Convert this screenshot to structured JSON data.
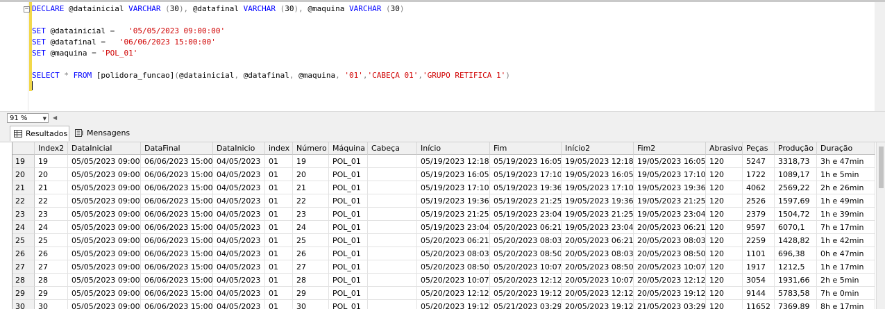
{
  "editor": {
    "lines": [
      [
        [
          "kw",
          "DECLARE "
        ],
        [
          "",
          "@datainicial "
        ],
        [
          "kw",
          "VARCHAR "
        ],
        [
          "gr",
          "("
        ],
        [
          "",
          "30"
        ],
        [
          "gr",
          "), "
        ],
        [
          "",
          "@datafinal "
        ],
        [
          "kw",
          "VARCHAR "
        ],
        [
          "gr",
          "("
        ],
        [
          "",
          "30"
        ],
        [
          "gr",
          "), "
        ],
        [
          "",
          "@maquina "
        ],
        [
          "kw",
          "VARCHAR "
        ],
        [
          "gr",
          "("
        ],
        [
          "",
          "30"
        ],
        [
          "gr",
          ")"
        ]
      ],
      [],
      [
        [
          "kw",
          "SET "
        ],
        [
          "",
          "@datainicial "
        ],
        [
          "gr",
          "= "
        ],
        [
          "str",
          "  '05/05/2023 09:00:00'"
        ]
      ],
      [
        [
          "kw",
          "SET "
        ],
        [
          "",
          "@datafinal "
        ],
        [
          "gr",
          "= "
        ],
        [
          "str",
          "  '06/06/2023 15:00:00'"
        ]
      ],
      [
        [
          "kw",
          "SET "
        ],
        [
          "",
          "@maquina "
        ],
        [
          "gr",
          "= "
        ],
        [
          "str",
          "'POL_01'"
        ]
      ],
      [],
      [
        [
          "kw",
          "SELECT "
        ],
        [
          "gr",
          "* "
        ],
        [
          "kw",
          "FROM "
        ],
        [
          "",
          "[polidora_funcao]"
        ],
        [
          "gr",
          "("
        ],
        [
          "",
          "@datainicial"
        ],
        [
          "gr",
          ", "
        ],
        [
          "",
          "@datafinal"
        ],
        [
          "gr",
          ", "
        ],
        [
          "",
          "@maquina"
        ],
        [
          "gr",
          ", "
        ],
        [
          "str",
          "'01'"
        ],
        [
          "gr",
          ","
        ],
        [
          "str",
          "'CABEÇA 01'"
        ],
        [
          "gr",
          ","
        ],
        [
          "str",
          "'GRUPO RETIFICA 1'"
        ],
        [
          "gr",
          ")"
        ]
      ]
    ]
  },
  "zoom": {
    "value": "91 %"
  },
  "tabs": {
    "results": "Resultados",
    "messages": "Mensagens"
  },
  "grid": {
    "columns": [
      "",
      "Index2",
      "DataInicial",
      "DataFinal",
      "DataInicio",
      "index",
      "Número",
      "Máquina",
      "Cabeça",
      "Início",
      "Fim",
      "Início2",
      "Fim2",
      "Abrasivo",
      "Peças",
      "Produção",
      "Duração"
    ],
    "rows": [
      [
        "19",
        "19",
        "05/05/2023 09:00",
        "06/06/2023 15:00",
        "04/05/2023",
        "01",
        "19",
        "POL_01",
        "",
        "05/19/2023 12:18",
        "05/19/2023 16:05",
        "19/05/2023 12:18",
        "19/05/2023 16:05",
        "120",
        "5247",
        "3318,73",
        "3h e 47min"
      ],
      [
        "20",
        "20",
        "05/05/2023 09:00",
        "06/06/2023 15:00",
        "04/05/2023",
        "01",
        "20",
        "POL_01",
        "",
        "05/19/2023 16:05",
        "05/19/2023 17:10",
        "19/05/2023 16:05",
        "19/05/2023 17:10",
        "120",
        "1722",
        "1089,17",
        "1h e 5min"
      ],
      [
        "21",
        "21",
        "05/05/2023 09:00",
        "06/06/2023 15:00",
        "04/05/2023",
        "01",
        "21",
        "POL_01",
        "",
        "05/19/2023 17:10",
        "05/19/2023 19:36",
        "19/05/2023 17:10",
        "19/05/2023 19:36",
        "120",
        "4062",
        "2569,22",
        "2h e 26min"
      ],
      [
        "22",
        "22",
        "05/05/2023 09:00",
        "06/06/2023 15:00",
        "04/05/2023",
        "01",
        "22",
        "POL_01",
        "",
        "05/19/2023 19:36",
        "05/19/2023 21:25",
        "19/05/2023 19:36",
        "19/05/2023 21:25",
        "120",
        "2526",
        "1597,69",
        "1h e 49min"
      ],
      [
        "23",
        "23",
        "05/05/2023 09:00",
        "06/06/2023 15:00",
        "04/05/2023",
        "01",
        "23",
        "POL_01",
        "",
        "05/19/2023 21:25",
        "05/19/2023 23:04",
        "19/05/2023 21:25",
        "19/05/2023 23:04",
        "120",
        "2379",
        "1504,72",
        "1h e 39min"
      ],
      [
        "24",
        "24",
        "05/05/2023 09:00",
        "06/06/2023 15:00",
        "04/05/2023",
        "01",
        "24",
        "POL_01",
        "",
        "05/19/2023 23:04",
        "05/20/2023 06:21",
        "19/05/2023 23:04",
        "20/05/2023 06:21",
        "120",
        "9597",
        "6070,1",
        "7h e 17min"
      ],
      [
        "25",
        "25",
        "05/05/2023 09:00",
        "06/06/2023 15:00",
        "04/05/2023",
        "01",
        "25",
        "POL_01",
        "",
        "05/20/2023 06:21",
        "05/20/2023 08:03",
        "20/05/2023 06:21",
        "20/05/2023 08:03",
        "120",
        "2259",
        "1428,82",
        "1h e 42min"
      ],
      [
        "26",
        "26",
        "05/05/2023 09:00",
        "06/06/2023 15:00",
        "04/05/2023",
        "01",
        "26",
        "POL_01",
        "",
        "05/20/2023 08:03",
        "05/20/2023 08:50",
        "20/05/2023 08:03",
        "20/05/2023 08:50",
        "120",
        "1101",
        "696,38",
        "0h e 47min"
      ],
      [
        "27",
        "27",
        "05/05/2023 09:00",
        "06/06/2023 15:00",
        "04/05/2023",
        "01",
        "27",
        "POL_01",
        "",
        "05/20/2023 08:50",
        "05/20/2023 10:07",
        "20/05/2023 08:50",
        "20/05/2023 10:07",
        "120",
        "1917",
        "1212,5",
        "1h e 17min"
      ],
      [
        "28",
        "28",
        "05/05/2023 09:00",
        "06/06/2023 15:00",
        "04/05/2023",
        "01",
        "28",
        "POL_01",
        "",
        "05/20/2023 10:07",
        "05/20/2023 12:12",
        "20/05/2023 10:07",
        "20/05/2023 12:12",
        "120",
        "3054",
        "1931,66",
        "2h e 5min"
      ],
      [
        "29",
        "29",
        "05/05/2023 09:00",
        "06/06/2023 15:00",
        "04/05/2023",
        "01",
        "29",
        "POL_01",
        "",
        "05/20/2023 12:12",
        "05/20/2023 19:12",
        "20/05/2023 12:12",
        "20/05/2023 19:12",
        "120",
        "9144",
        "5783,58",
        "7h e 0min"
      ],
      [
        "30",
        "30",
        "05/05/2023 09:00",
        "06/06/2023 15:00",
        "04/05/2023",
        "01",
        "30",
        "POL_01",
        "",
        "05/20/2023 19:12",
        "05/21/2023 03:29",
        "20/05/2023 19:12",
        "21/05/2023 03:29",
        "120",
        "11652",
        "7369,89",
        "8h e 17min"
      ]
    ]
  }
}
